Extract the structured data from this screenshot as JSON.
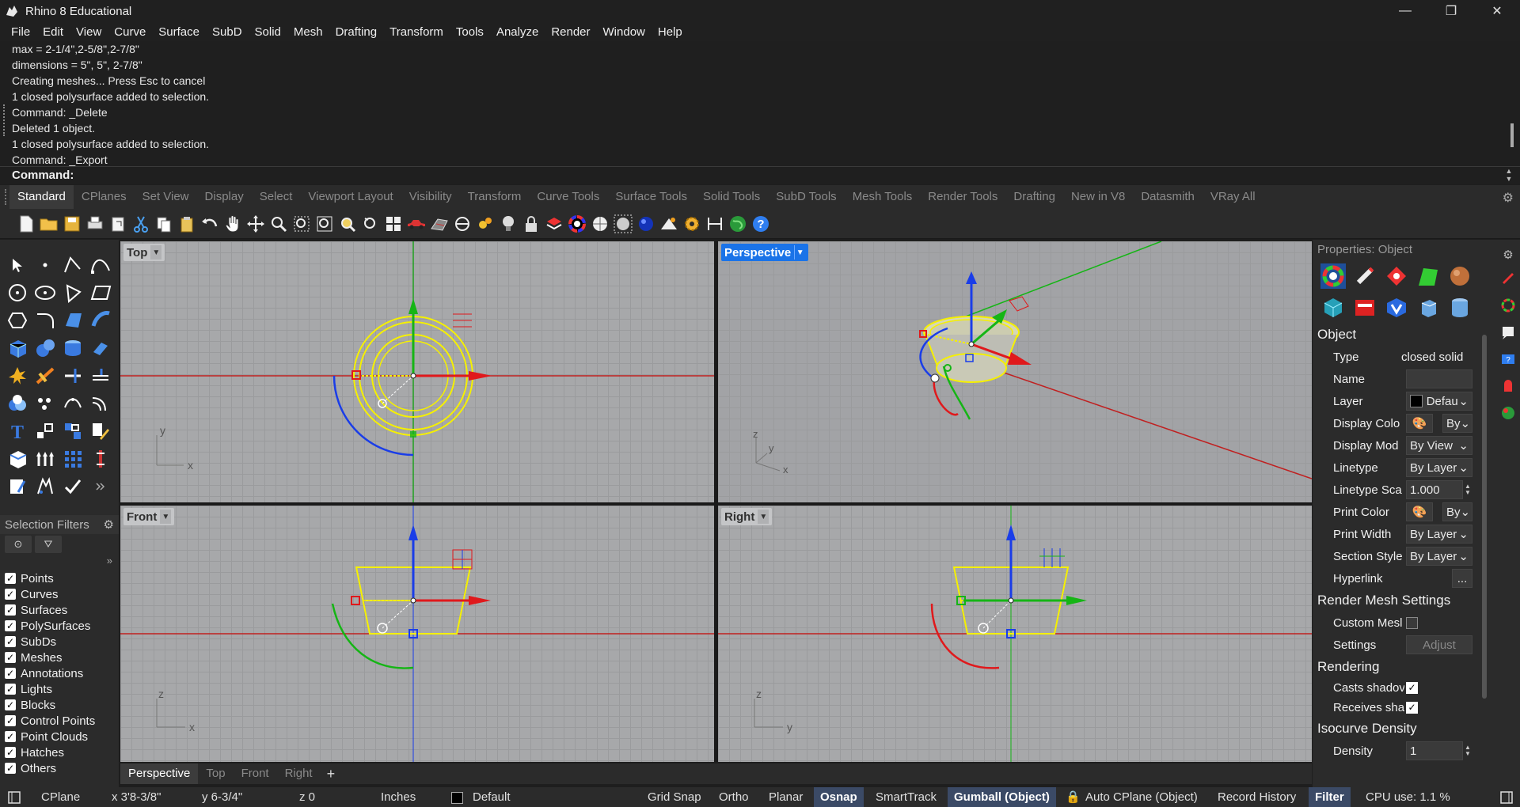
{
  "window": {
    "title": "Rhino 8 Educational",
    "minimize": "—",
    "maximize": "❐",
    "close": "✕"
  },
  "menu": [
    "File",
    "Edit",
    "View",
    "Curve",
    "Surface",
    "SubD",
    "Solid",
    "Mesh",
    "Drafting",
    "Transform",
    "Tools",
    "Analyze",
    "Render",
    "Window",
    "Help"
  ],
  "command_history": [
    "max = 2-1/4\",2-5/8\",2-7/8\"",
    "dimensions = 5\", 5\", 2-7/8\"",
    "Creating meshes... Press Esc to cancel",
    "1 closed polysurface added to selection.",
    "Command: _Delete",
    "Deleted 1 object.",
    "1 closed polysurface added to selection.",
    "Command: _Export"
  ],
  "command_prompt": "Command:",
  "toolbar_tabs": [
    "Standard",
    "CPlanes",
    "Set View",
    "Display",
    "Select",
    "Viewport Layout",
    "Visibility",
    "Transform",
    "Curve Tools",
    "Surface Tools",
    "Solid Tools",
    "SubD Tools",
    "Mesh Tools",
    "Render Tools",
    "Drafting",
    "New in V8",
    "Datasmith",
    "VRay All"
  ],
  "active_toolbar_tab": "Standard",
  "selection_filters": {
    "title": "Selection Filters",
    "items": [
      "Points",
      "Curves",
      "Surfaces",
      "PolySurfaces",
      "SubDs",
      "Meshes",
      "Annotations",
      "Lights",
      "Blocks",
      "Control Points",
      "Point Clouds",
      "Hatches",
      "Others"
    ]
  },
  "viewports": {
    "top": "Top",
    "perspective": "Perspective",
    "front": "Front",
    "right": "Right"
  },
  "viewport_tabs": [
    "Perspective",
    "Top",
    "Front",
    "Right"
  ],
  "active_viewport_tab": "Perspective",
  "properties": {
    "header": "Properties: Object",
    "section_object": "Object",
    "rows": {
      "type_label": "Type",
      "type_value": "closed solid",
      "name_label": "Name",
      "name_value": "",
      "layer_label": "Layer",
      "layer_value": "Defau",
      "display_color_label": "Display Colo",
      "display_color_value": "By",
      "display_mode_label": "Display Mod",
      "display_mode_value": "By View",
      "linetype_label": "Linetype",
      "linetype_value": "By Layer",
      "linetype_scale_label": "Linetype Sca",
      "linetype_scale_value": "1.000",
      "print_color_label": "Print Color",
      "print_color_value": "By",
      "print_width_label": "Print Width",
      "print_width_value": "By Layer",
      "section_style_label": "Section Style",
      "section_style_value": "By Layer",
      "hyperlink_label": "Hyperlink",
      "hyperlink_value": "..."
    },
    "section_render_mesh": "Render Mesh Settings",
    "custom_mesh_label": "Custom Mesl",
    "settings_label": "Settings",
    "adjust_label": "Adjust",
    "section_rendering": "Rendering",
    "casts_shadows_label": "Casts shadov",
    "receives_shadows_label": "Receives sha",
    "section_isocurve": "Isocurve Density",
    "density_label": "Density",
    "density_value": "1"
  },
  "status": {
    "cplane": "CPlane",
    "x": "x 3'8-3/8\"",
    "y": "y 6-3/4\"",
    "z": "z 0",
    "units": "Inches",
    "layer": "Default",
    "grid_snap": "Grid Snap",
    "ortho": "Ortho",
    "planar": "Planar",
    "osnap": "Osnap",
    "smarttrack": "SmartTrack",
    "gumball": "Gumball (Object)",
    "auto_cplane": "Auto CPlane (Object)",
    "record_history": "Record History",
    "filter": "Filter",
    "cpu": "CPU use: 1.1 %"
  },
  "colors": {
    "selection_yellow": "#f5f000",
    "axis_red": "#e0191c",
    "axis_green": "#15b515",
    "axis_blue": "#1a3de8",
    "active_viewport": "#1a73e8"
  }
}
